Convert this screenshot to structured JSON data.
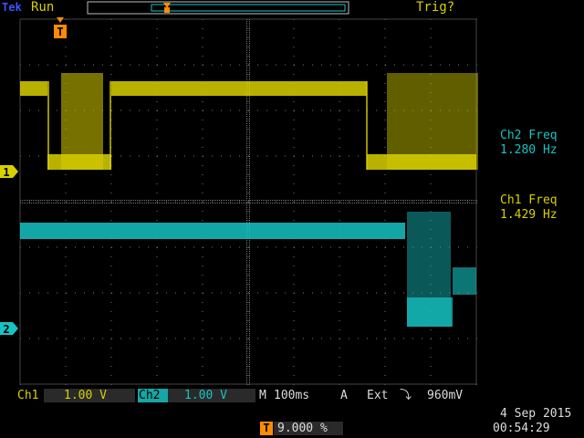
{
  "header": {
    "brand": "Tek",
    "run_status": "Run",
    "trigger_status": "Trig?"
  },
  "channel_markers": {
    "ch1": "1",
    "ch2": "2",
    "trigger": "T"
  },
  "measurements": {
    "ch2_label": "Ch2 Freq",
    "ch2_value": "1.280 Hz",
    "ch1_label": "Ch1 Freq",
    "ch1_value": "1.429 Hz"
  },
  "bottom_bar": {
    "ch1_label": "Ch1",
    "ch1_scale": "1.00 V",
    "ch2_label": "Ch2",
    "ch2_scale": "1.00 V",
    "timebase_label": "M",
    "timebase_value": "100ms",
    "trigger_mode": "A",
    "trigger_source": "Ext",
    "trigger_slope": "⤵",
    "trigger_level": "960mV",
    "trigger_position": "9.000 %",
    "date": "4 Sep  2015",
    "time": "00:54:29"
  },
  "colors": {
    "ch1": "#d8d000",
    "ch2": "#17c3c3",
    "grid": "#777777",
    "trigger_marker": "#ff8c00"
  }
}
